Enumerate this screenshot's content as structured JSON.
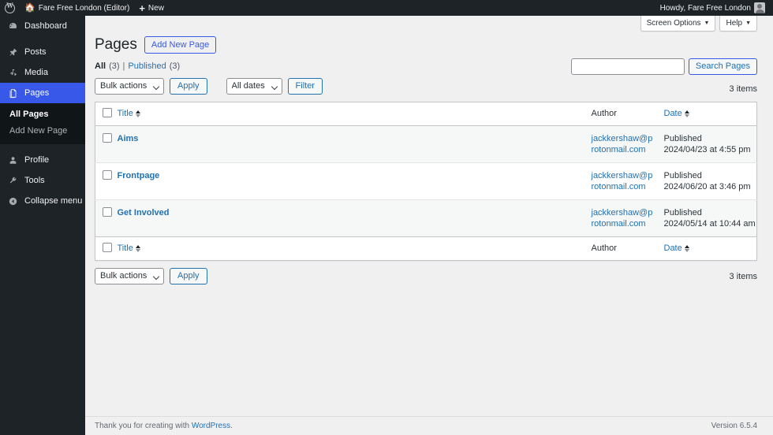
{
  "adminbar": {
    "logo_icon": "wordpress-logo-icon",
    "site_name": "Fare Free London (Editor)",
    "site_icon": "home-icon",
    "new_label": "New",
    "new_icon": "plus-icon",
    "howdy": "Howdy, Fare Free London",
    "avatar_icon": "avatar-icon"
  },
  "sidebar": {
    "items": [
      {
        "label": "Dashboard",
        "icon": "dashboard-icon",
        "glyph": "⚙",
        "current": false
      },
      {
        "label": "Posts",
        "icon": "posts-pin-icon",
        "glyph": "✒",
        "current": false
      },
      {
        "label": "Media",
        "icon": "media-icon",
        "glyph": "♫",
        "current": false
      },
      {
        "label": "Pages",
        "icon": "pages-icon",
        "glyph": "❐",
        "current": true
      },
      {
        "label": "Profile",
        "icon": "profile-user-icon",
        "glyph": "♟",
        "current": false
      },
      {
        "label": "Tools",
        "icon": "tools-wrench-icon",
        "glyph": "⚒",
        "current": false
      },
      {
        "label": "Collapse menu",
        "icon": "collapse-arrow-icon",
        "glyph": "◀",
        "current": false
      }
    ],
    "submenu": [
      {
        "label": "All Pages",
        "current": true
      },
      {
        "label": "Add New Page",
        "current": false
      }
    ]
  },
  "screen_meta": {
    "screen_options_label": "Screen Options",
    "help_label": "Help",
    "caret_icon": "chevron-down-icon"
  },
  "header": {
    "title": "Pages",
    "add_new_label": "Add New Page"
  },
  "views": {
    "all_label": "All",
    "all_count": "(3)",
    "separator": "|",
    "published_label": "Published",
    "published_count": "(3)"
  },
  "search": {
    "value": "",
    "placeholder": "",
    "submit_label": "Search Pages"
  },
  "tablenav_top": {
    "bulk_actions_label": "Bulk actions",
    "apply_label": "Apply",
    "dates_label": "All dates",
    "filter_label": "Filter",
    "items_count": "3 items"
  },
  "tablenav_bottom": {
    "bulk_actions_label": "Bulk actions",
    "apply_label": "Apply",
    "items_count": "3 items"
  },
  "table": {
    "columns": {
      "title": "Title",
      "author": "Author",
      "date": "Date"
    },
    "rows": [
      {
        "title": "Aims",
        "author_line1": "jackkershaw@proto",
        "author_line2": "nmail.com",
        "status": "Published",
        "date": "2024/04/23 at 4:55 pm"
      },
      {
        "title": "Frontpage",
        "author_line1": "jackkershaw@proto",
        "author_line2": "nmail.com",
        "status": "Published",
        "date": "2024/06/20 at 3:46 pm"
      },
      {
        "title": "Get Involved",
        "author_line1": "jackkershaw@proto",
        "author_line2": "nmail.com",
        "status": "Published",
        "date": "2024/05/14 at 10:44 am"
      }
    ]
  },
  "footer": {
    "thanks_prefix": "Thank you for creating with ",
    "wordpress_link": "WordPress",
    "thanks_suffix": ".",
    "version": "Version 6.5.4"
  }
}
